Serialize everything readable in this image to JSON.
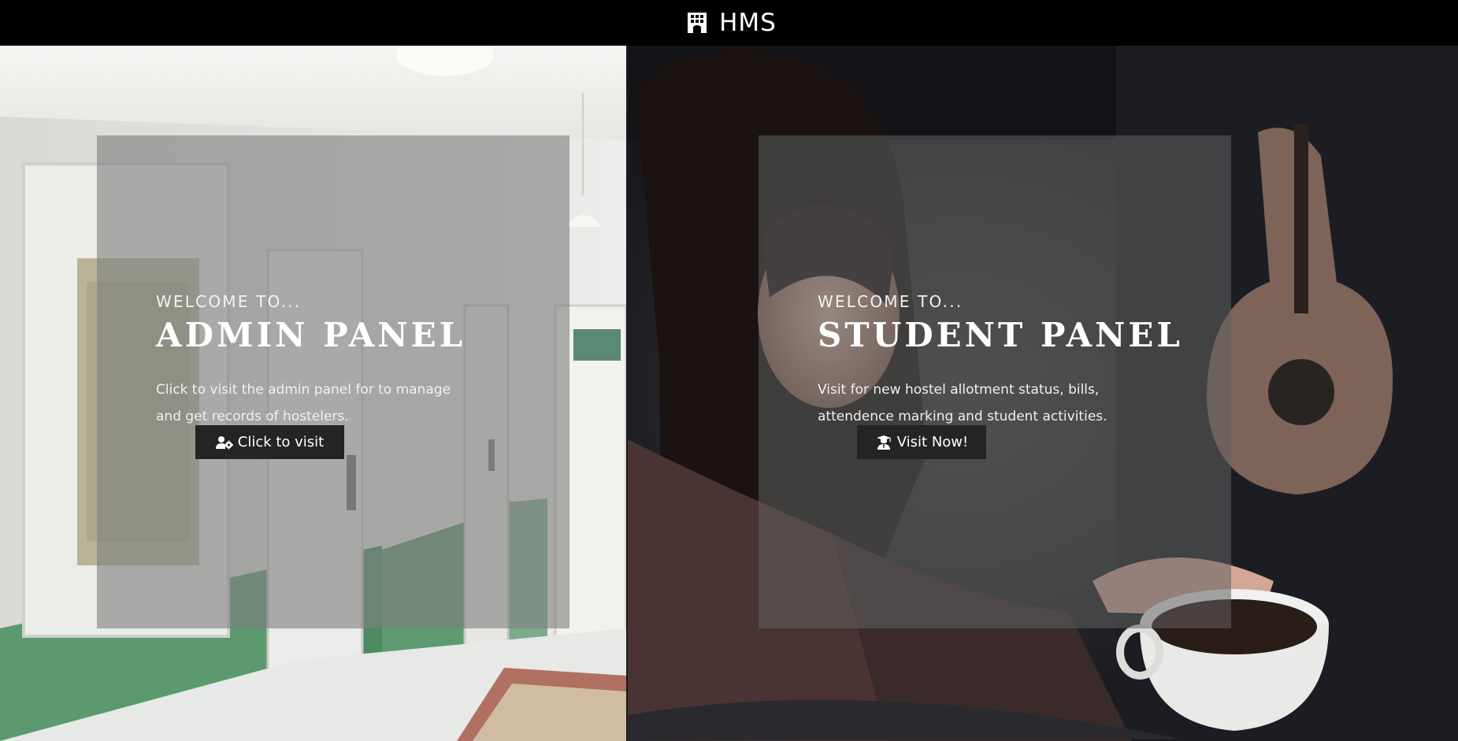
{
  "header": {
    "brand_icon": "hotel-building-icon",
    "brand_text": "HMS"
  },
  "admin_panel": {
    "welcome": "WELCOME TO...",
    "title": "ADMIN PANEL",
    "description": "Click to visit the admin panel for to manage and get records of hostelers.",
    "button_icon": "users-cog-icon",
    "button_label": "Click to visit"
  },
  "student_panel": {
    "welcome": "WELCOME TO...",
    "title": "STUDENT PANEL",
    "description": "Visit for new hostel allotment status, bills, attendence marking and student activities.",
    "button_icon": "user-graduate-icon",
    "button_label": "Visit Now!"
  },
  "colors": {
    "topbar": "#000000",
    "button": "#242424",
    "text": "#ffffff"
  }
}
